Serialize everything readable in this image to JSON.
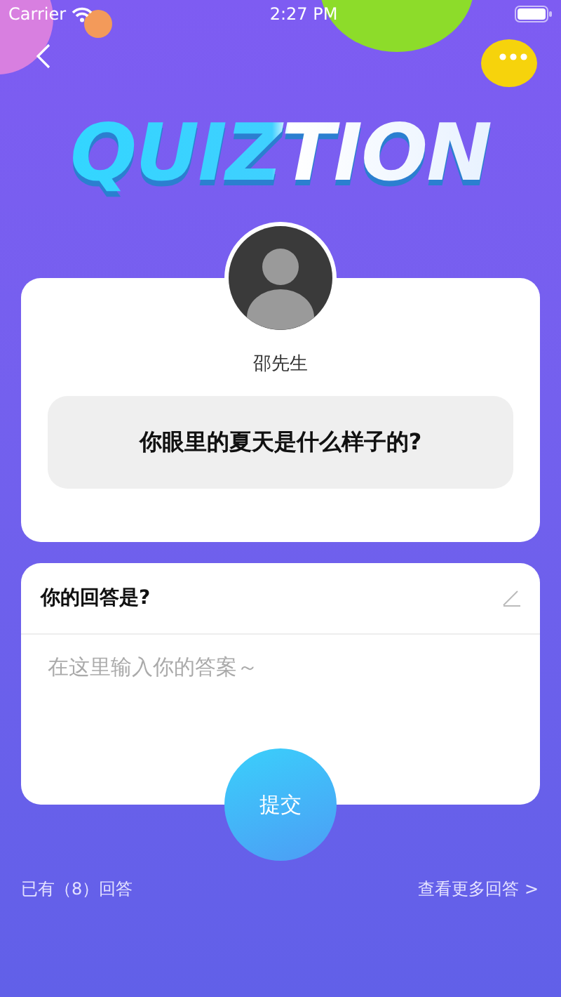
{
  "status_bar": {
    "carrier": "Carrier",
    "time": "2:27 PM"
  },
  "logo": "QUIZTION",
  "question_card": {
    "author": "邵先生",
    "question": "你眼里的夏天是什么样子的?"
  },
  "answer_card": {
    "title": "你的回答是?",
    "placeholder": "在这里输入你的答案～"
  },
  "submit_button": "提交",
  "footer": {
    "answer_count": "已有（8）回答",
    "more_link": "查看更多回答 >"
  }
}
